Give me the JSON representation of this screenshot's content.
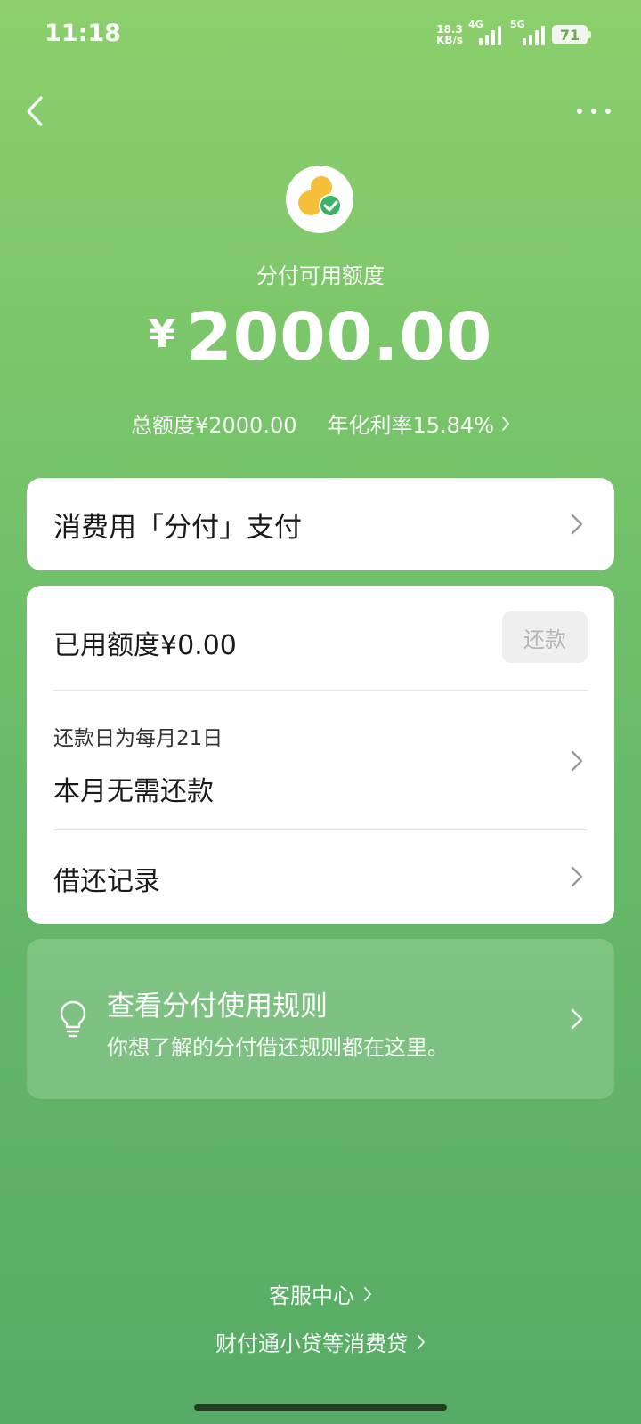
{
  "status_bar": {
    "time": "11:18",
    "net_speed_value": "18.3",
    "net_speed_unit": "KB/s",
    "signal1_label": "4G",
    "signal2_label": "5G",
    "battery": "71"
  },
  "header": {
    "back_icon": "chevron-left-icon",
    "more_icon": "more-dots-icon"
  },
  "summary": {
    "label": "分付可用额度",
    "currency": "¥",
    "amount": "2000.00",
    "total_limit": "总额度¥2000.00",
    "annual_rate": "年化利率15.84%"
  },
  "pay_card": {
    "label": "消费用「分付」支付"
  },
  "main_card": {
    "used_amount": "已用额度¥0.00",
    "repay_button": "还款",
    "due_date": "还款日为每月21日",
    "due_status": "本月无需还款",
    "records": "借还记录"
  },
  "rules_card": {
    "title": "查看分付使用规则",
    "description": "你想了解的分付借还规则都在这里。"
  },
  "footer": {
    "service": "客服中心",
    "lenders": "财付通小贷等消费贷"
  },
  "colors": {
    "bg_top": "#8ccf6c",
    "bg_bottom": "#58ab66",
    "logo_yellow": "#f5bf3a",
    "logo_green": "#3bb463"
  }
}
